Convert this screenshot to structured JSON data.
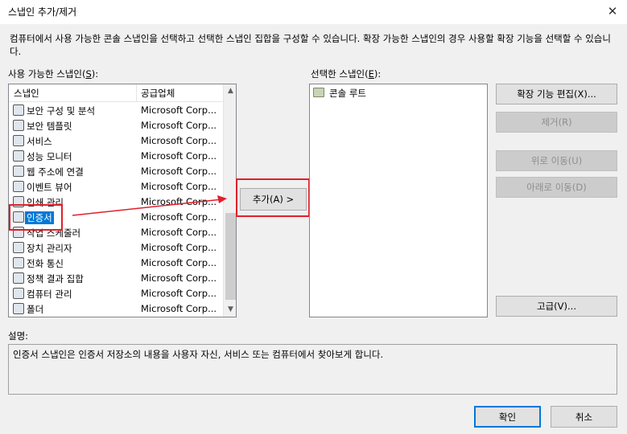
{
  "window": {
    "title": "스냅인 추가/제거",
    "close_glyph": "✕"
  },
  "intro_text": "컴퓨터에서 사용 가능한 콘솔 스냅인을 선택하고 선택한 스냅인 집합을 구성할 수 있습니다. 확장 가능한 스냅인의 경우 사용할 확장 기능을 선택할 수 있습니다.",
  "available": {
    "label": "사용 가능한 스냅인",
    "accel": "S",
    "columns": [
      "스냅인",
      "공급업체"
    ],
    "rows": [
      {
        "name": "보안 구성 및 분석",
        "vendor": "Microsoft Corp...",
        "icon": "security-analysis-icon"
      },
      {
        "name": "보안 템플릿",
        "vendor": "Microsoft Corp...",
        "icon": "security-template-icon"
      },
      {
        "name": "서비스",
        "vendor": "Microsoft Corp...",
        "icon": "services-gear-icon"
      },
      {
        "name": "성능 모니터",
        "vendor": "Microsoft Corp...",
        "icon": "performance-monitor-icon"
      },
      {
        "name": "웹 주소에 연결",
        "vendor": "Microsoft Corp...",
        "icon": "web-link-icon"
      },
      {
        "name": "이벤트 뷰어",
        "vendor": "Microsoft Corp...",
        "icon": "event-viewer-icon"
      },
      {
        "name": "인쇄 관리",
        "vendor": "Microsoft Corp...",
        "icon": "print-management-icon"
      },
      {
        "name": "인증서",
        "vendor": "Microsoft Corp...",
        "icon": "certificate-icon",
        "selected": true
      },
      {
        "name": "작업 스케줄러",
        "vendor": "Microsoft Corp...",
        "icon": "task-scheduler-icon"
      },
      {
        "name": "장치 관리자",
        "vendor": "Microsoft Corp...",
        "icon": "device-manager-icon"
      },
      {
        "name": "전화 통신",
        "vendor": "Microsoft Corp...",
        "icon": "telephony-icon"
      },
      {
        "name": "정책 결과 집합",
        "vendor": "Microsoft Corp...",
        "icon": "policy-result-icon"
      },
      {
        "name": "컴퓨터 관리",
        "vendor": "Microsoft Corp...",
        "icon": "computer-management-icon"
      },
      {
        "name": "폴더",
        "vendor": "Microsoft Corp...",
        "icon": "folder-icon"
      }
    ]
  },
  "selected": {
    "label": "선택한 스냅인",
    "accel": "E",
    "items": [
      {
        "name": "콘솔 루트",
        "icon": "console-root-folder-icon"
      }
    ]
  },
  "buttons": {
    "add": "추가(A) >",
    "edit_ext": "확장 기능 편집(X)...",
    "remove": "제거(R)",
    "move_up": "위로 이동(U)",
    "move_down": "아래로 이동(D)",
    "advanced": "고급(V)...",
    "ok": "확인",
    "cancel": "취소"
  },
  "description": {
    "label": "설명:",
    "text": "인증서 스냅인은 인증서 저장소의 내용을 사용자 자신, 서비스 또는 컴퓨터에서 찾아보게 합니다."
  },
  "colors": {
    "accent": "#0078d7",
    "highlight": "#e0202a"
  }
}
